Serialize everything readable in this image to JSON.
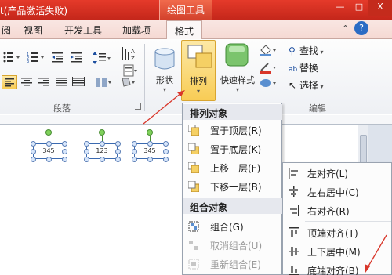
{
  "titlebar": {
    "title": "t(产品激活失败)",
    "context_tab": "绘图工具",
    "minimize": "—",
    "restore": "□",
    "close": "X"
  },
  "tabs": [
    {
      "label": "阅"
    },
    {
      "label": "视图"
    },
    {
      "label": "开发工具"
    },
    {
      "label": "加载项"
    },
    {
      "label": "格式"
    }
  ],
  "ribbon": {
    "paragraph_group_label": "段落",
    "shape_button": "形状",
    "arrange_button": "排列",
    "quick_styles_button": "快速样式",
    "edit_group_label": "编辑",
    "find": "查找",
    "replace": "替换",
    "select": "选择"
  },
  "shapes": [
    {
      "text": "345"
    },
    {
      "text": "123"
    },
    {
      "text": "345"
    }
  ],
  "arrange_menu": {
    "header_arrange": "排列对象",
    "items": [
      {
        "label": "置于顶层(R)"
      },
      {
        "label": "置于底层(K)"
      },
      {
        "label": "上移一层(F)"
      },
      {
        "label": "下移一层(B)"
      }
    ],
    "header_group": "组合对象",
    "group_items": [
      {
        "label": "组合(G)",
        "disabled": false
      },
      {
        "label": "取消组合(U)",
        "disabled": true
      },
      {
        "label": "重新组合(E)",
        "disabled": true
      }
    ]
  },
  "align_menu": {
    "items": [
      {
        "label": "左对齐(L)"
      },
      {
        "label": "左右居中(C)"
      },
      {
        "label": "右对齐(R)"
      },
      {
        "label": "顶端对齐(T)"
      },
      {
        "label": "上下居中(M)"
      },
      {
        "label": "底端对齐(B)"
      }
    ]
  },
  "colors": {
    "title_red": "#d2301f",
    "accent_gold": "#f8cc55",
    "arrow_red": "#d9362a"
  }
}
